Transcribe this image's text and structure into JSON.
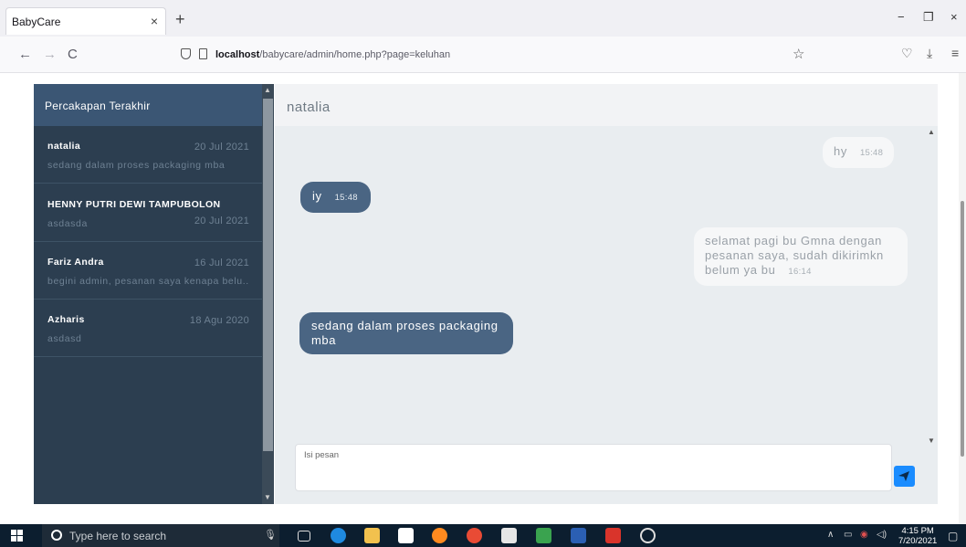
{
  "browser": {
    "tab_title": "BabyCare",
    "tab_close": "×",
    "new_tab": "+",
    "url_host": "localhost",
    "url_path": "/babycare/admin/home.php?page=keluhan",
    "controls": {
      "minimize": "−",
      "restore": "❐",
      "close": "×"
    },
    "nav": {
      "back": "←",
      "forward": "→",
      "reload": "C"
    },
    "bookmark_star": "☆",
    "pocket": "♡",
    "download": "⤓",
    "menu": "≡"
  },
  "sidebar": {
    "title": "Percakapan Terakhir",
    "conversations": [
      {
        "name": "natalia",
        "date": "20 Jul 2021",
        "preview": "sedang dalam proses packaging mba"
      },
      {
        "name": "HENNY PUTRI DEWI TAMPUBOLON",
        "date": "20 Jul 2021",
        "preview": "asdasda"
      },
      {
        "name": "Fariz Andra",
        "date": "16 Jul 2021",
        "preview": "begini admin, pesanan saya kenapa belu..."
      },
      {
        "name": "Azharis",
        "date": "18 Agu 2020",
        "preview": "asdasd"
      }
    ]
  },
  "chat": {
    "header_name": "natalia",
    "messages": [
      {
        "side": "in",
        "text": "hy",
        "time": "15:48"
      },
      {
        "side": "out",
        "text": "iy",
        "time": "15:48"
      },
      {
        "side": "in",
        "text": "selamat pagi bu Gmna dengan pesanan saya, sudah dikirimkn belum ya bu",
        "time": "16:14"
      },
      {
        "side": "out",
        "text": "sedang dalam proses packaging mba",
        "time": ""
      }
    ],
    "input_placeholder": "Isi pesan"
  },
  "taskbar": {
    "search_placeholder": "Type here to search",
    "clock_time": "4:15 PM",
    "clock_date": "7/20/2021"
  },
  "colors": {
    "sidebar_bg": "#2c3e50",
    "sidebar_header": "#3b5674",
    "bubble_out": "#4a6583",
    "send_button": "#1a8cff"
  }
}
